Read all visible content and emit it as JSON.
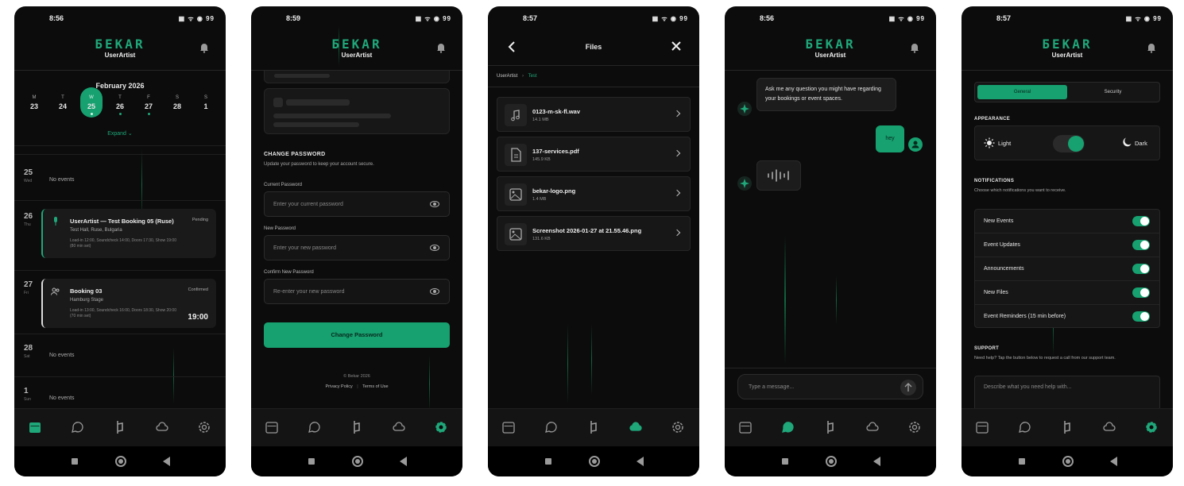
{
  "colors": {
    "accent": "#1fa77a",
    "background": "#0c0c0c",
    "card": "#1a1a1a"
  },
  "brand": {
    "logo": "БЕКАR",
    "user": "UserArtist"
  },
  "icons": [
    "bell-icon",
    "calendar-icon",
    "chat-icon",
    "bekar-logo-icon",
    "cloud-icon",
    "gear-icon",
    "eye-icon",
    "music-file-icon",
    "pdf-file-icon",
    "image-file-icon",
    "send-icon",
    "sun-icon",
    "moon-icon",
    "mic-icon",
    "people-icon",
    "sparkle-icon",
    "user-icon"
  ],
  "screens": {
    "calendar": {
      "time": "8:56",
      "status_icons": "▦ ᯤ ◉ 99",
      "month": "February 2026",
      "days": [
        {
          "label": "M",
          "num": "23",
          "dot": false
        },
        {
          "label": "T",
          "num": "24",
          "dot": false
        },
        {
          "label": "W",
          "num": "25",
          "dot": true
        },
        {
          "label": "T",
          "num": "26",
          "dot": true
        },
        {
          "label": "F",
          "num": "27",
          "dot": true
        },
        {
          "label": "S",
          "num": "28",
          "dot": false
        },
        {
          "label": "S",
          "num": "1",
          "dot": false
        }
      ],
      "expand": "Expand",
      "rows": [
        {
          "num": "25",
          "dow": "Wed",
          "text": "No events"
        },
        {
          "num": "26",
          "dow": "Thu"
        },
        {
          "num": "27",
          "dow": "Fri"
        },
        {
          "num": "28",
          "dow": "Sat",
          "text": "No events"
        },
        {
          "num": "1",
          "dow": "Sun",
          "text": "No events"
        }
      ],
      "cards": [
        {
          "title": "UserArtist — Test Booking 05 (Ruse)",
          "sub": "Test Hall, Ruse, Bulgaria",
          "details": "Load-in 12:00, Soundcheck 14:00, Doors 17:30, Show 19:00 (80 min set)",
          "status": "Pending",
          "time": ""
        },
        {
          "title": "Booking 03",
          "sub": "Hamburg Stage",
          "details": "Load-in 13:00, Soundcheck 16:00, Doors 18:30, Show 20:00 (70 min set)",
          "status": "Confirmed",
          "time": "19:00"
        }
      ]
    },
    "password": {
      "time": "8:59",
      "status_icons": "▦ ᯤ ◉ 99",
      "title": "CHANGE PASSWORD",
      "subtitle": "Update your password to keep your account secure.",
      "fields": [
        {
          "label": "Current Password",
          "placeholder": "Enter your current password"
        },
        {
          "label": "New Password",
          "placeholder": "Enter your new password"
        },
        {
          "label": "Confirm New Password",
          "placeholder": "Re-enter your new password"
        }
      ],
      "button": "Change Password",
      "copyright": "© Bekar 2026",
      "privacy": "Privacy Policy",
      "terms": "Terms of Use"
    },
    "files": {
      "time": "8:57",
      "status_icons": "▦ ᯤ ◉ 99",
      "title": "Files",
      "crumb_root": "UserArtist",
      "crumb_current": "Test",
      "items": [
        {
          "name": "0123-m-sk-fl.wav",
          "size": "14.1 MB",
          "icon": "music-file-icon"
        },
        {
          "name": "137-services.pdf",
          "size": "145.9 KB",
          "icon": "pdf-file-icon"
        },
        {
          "name": "bekar-logo.png",
          "size": "1.4 MB",
          "icon": "image-file-icon"
        },
        {
          "name": "Screenshot 2026-01-27 at 21.55.46.png",
          "size": "131.6 KB",
          "icon": "image-file-icon"
        }
      ]
    },
    "chat": {
      "time": "8:56",
      "status_icons": "▦ ᯤ ◉ 99",
      "bot_message": "Ask me any question you might have regarding your bookings or event spaces.",
      "user_message": "hey",
      "input_placeholder": "Type a message..."
    },
    "settings": {
      "time": "8:57",
      "status_icons": "▦ ᯤ ◉ 99",
      "tab_general": "General",
      "tab_security": "Security",
      "appearance_title": "APPEARANCE",
      "light": "Light",
      "dark": "Dark",
      "notifications_title": "NOTIFICATIONS",
      "notifications_sub": "Choose which notifications you want to receive.",
      "notifications": [
        "New Events",
        "Event Updates",
        "Announcements",
        "New Files",
        "Event Reminders (15 min before)"
      ],
      "support_title": "SUPPORT",
      "support_sub": "Need help? Tap the button below to request a call from our support team.",
      "support_placeholder": "Describe what you need help with..."
    }
  }
}
